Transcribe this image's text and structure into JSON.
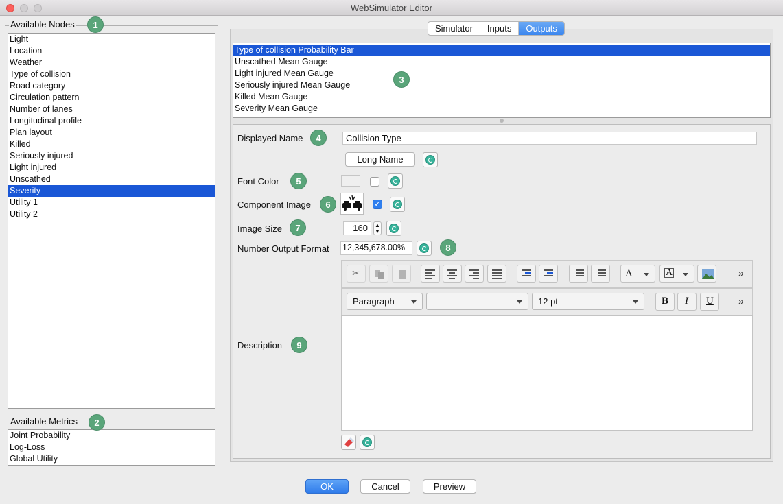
{
  "window": {
    "title": "WebSimulator Editor"
  },
  "nodes": {
    "legend": "Available Nodes",
    "items": [
      "Light",
      "Location",
      "Weather",
      "Type of collision",
      "Road category",
      "Circulation pattern",
      "Number of lanes",
      "Longitudinal profile",
      "Plan layout",
      "Killed",
      "Seriously injured",
      "Light injured",
      "Unscathed",
      "Severity",
      "Utility 1",
      "Utility 2"
    ],
    "selected": "Severity"
  },
  "metrics": {
    "legend": "Available Metrics",
    "items": [
      "Joint Probability",
      "Log-Loss",
      "Global Utility"
    ]
  },
  "tabs": {
    "items": [
      "Simulator",
      "Inputs",
      "Outputs"
    ],
    "active": "Outputs"
  },
  "outputs": {
    "items": [
      "Type of collision Probability Bar",
      "Unscathed Mean Gauge",
      "Light injured Mean Gauge",
      "Seriously injured Mean Gauge",
      "Killed Mean Gauge",
      "Severity Mean Gauge"
    ],
    "selected": "Type of collision Probability Bar"
  },
  "form": {
    "displayed_name_label": "Displayed Name",
    "displayed_name_value": "Collision Type",
    "long_name_button": "Long Name",
    "font_color_label": "Font Color",
    "font_color_checked": false,
    "component_image_label": "Component Image",
    "component_image_checked": true,
    "image_size_label": "Image Size",
    "image_size_value": "160",
    "number_format_label": "Number Output Format",
    "number_format_value": "12,345,678.00%",
    "description_label": "Description"
  },
  "editor": {
    "paragraph_select": "Paragraph",
    "font_select": "",
    "size_select": "12 pt",
    "bold": "B",
    "italic": "I",
    "underline": "U",
    "more": "»"
  },
  "badges": [
    "1",
    "2",
    "3",
    "4",
    "5",
    "6",
    "7",
    "8",
    "9"
  ],
  "buttons": {
    "ok": "OK",
    "cancel": "Cancel",
    "preview": "Preview"
  },
  "colors": {
    "selection": "#1a57d6",
    "badge": "#5aa57a",
    "accent": "#3b86ee"
  }
}
